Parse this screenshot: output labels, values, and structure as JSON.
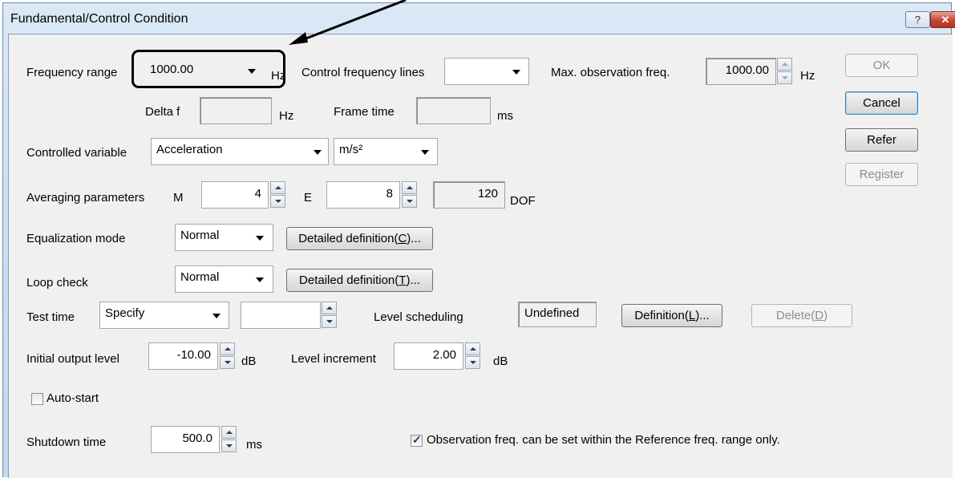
{
  "window": {
    "title": "Fundamental/Control Condition",
    "help_icon": "?",
    "close_icon": "✕"
  },
  "freq_range": {
    "label": "Frequency range",
    "value": "1000.00",
    "unit": "Hz"
  },
  "control_lines": {
    "label": "Control frequency lines",
    "value": ""
  },
  "max_obs": {
    "label": "Max. observation freq.",
    "value": "1000.00",
    "unit": "Hz"
  },
  "delta_f": {
    "label": "Delta f",
    "value": "",
    "unit": "Hz"
  },
  "frame_time": {
    "label": "Frame time",
    "value": "",
    "unit": "ms"
  },
  "controlled_variable": {
    "label": "Controlled variable",
    "value": "Acceleration",
    "unit_value": "m/s²"
  },
  "averaging": {
    "label": "Averaging parameters",
    "m_label": "M",
    "m_value": "4",
    "e_label": "E",
    "e_value": "8",
    "dof_value": "120",
    "dof_label": "DOF"
  },
  "equalization": {
    "label": "Equalization mode",
    "value": "Normal",
    "detail_prefix": "Detailed definition(",
    "detail_key": "C",
    "detail_suffix": ")..."
  },
  "loop_check": {
    "label": "Loop check",
    "value": "Normal",
    "detail_prefix": "Detailed definition(",
    "detail_key": "T",
    "detail_suffix": ")..."
  },
  "test_time": {
    "label": "Test time",
    "value": "Specify",
    "time_value": ""
  },
  "level_scheduling": {
    "label": "Level scheduling",
    "status": "Undefined",
    "definition_prefix": "Definition(",
    "definition_key": "L",
    "definition_suffix": ")...",
    "delete_prefix": "Delete(",
    "delete_key": "D",
    "delete_suffix": ")"
  },
  "initial_output": {
    "label": "Initial output level",
    "value": "-10.00",
    "unit": "dB"
  },
  "level_increment": {
    "label": "Level increment",
    "value": "2.00",
    "unit": "dB"
  },
  "auto_start": {
    "label": "Auto-start",
    "checked": false
  },
  "shutdown": {
    "label": "Shutdown time",
    "value": "500.0",
    "unit": "ms"
  },
  "observation_check": {
    "label": "Observation freq. can be set within the Reference freq. range only.",
    "checked": true
  },
  "buttons": {
    "ok": "OK",
    "cancel": "Cancel",
    "refer": "Refer",
    "register": "Register"
  }
}
